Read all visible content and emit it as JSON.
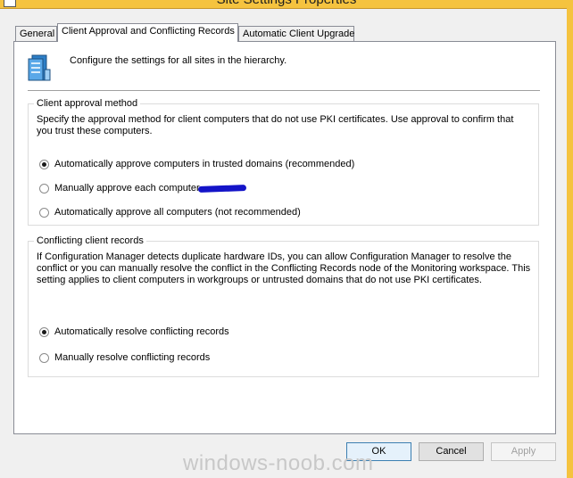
{
  "window": {
    "title": "Site Settings Properties",
    "accent_color": "#f5c33f"
  },
  "tabs": [
    {
      "label": "General",
      "active": false
    },
    {
      "label": "Client Approval and Conflicting Records",
      "active": true
    },
    {
      "label": "Automatic Client Upgrade",
      "active": false
    }
  ],
  "header": {
    "icon": "server-settings-icon",
    "text": "Configure the settings for all sites in the hierarchy."
  },
  "approval_group": {
    "title": "Client approval method",
    "description": "Specify the approval method for client computers that do not use PKI certificates. Use approval to confirm that you trust these computers.",
    "options": [
      {
        "label": "Automatically approve computers in trusted domains (recommended)",
        "checked": true
      },
      {
        "label": "Manually approve each computer",
        "checked": false
      },
      {
        "label": "Automatically approve all computers (not recommended)",
        "checked": false
      }
    ]
  },
  "conflict_group": {
    "title": "Conflicting client records",
    "description": "If Configuration Manager detects duplicate hardware IDs, you can allow Configuration Manager to resolve the conflict or you can manually resolve the conflict in the Conflicting Records node of the Monitoring workspace. This setting applies to client computers in workgroups or untrusted domains that do not use PKI certificates.",
    "options": [
      {
        "label": "Automatically resolve conflicting records",
        "checked": true
      },
      {
        "label": "Manually resolve conflicting records",
        "checked": false
      }
    ]
  },
  "buttons": {
    "ok": "OK",
    "cancel": "Cancel",
    "apply": "Apply"
  },
  "watermark": "windows-noob.com"
}
